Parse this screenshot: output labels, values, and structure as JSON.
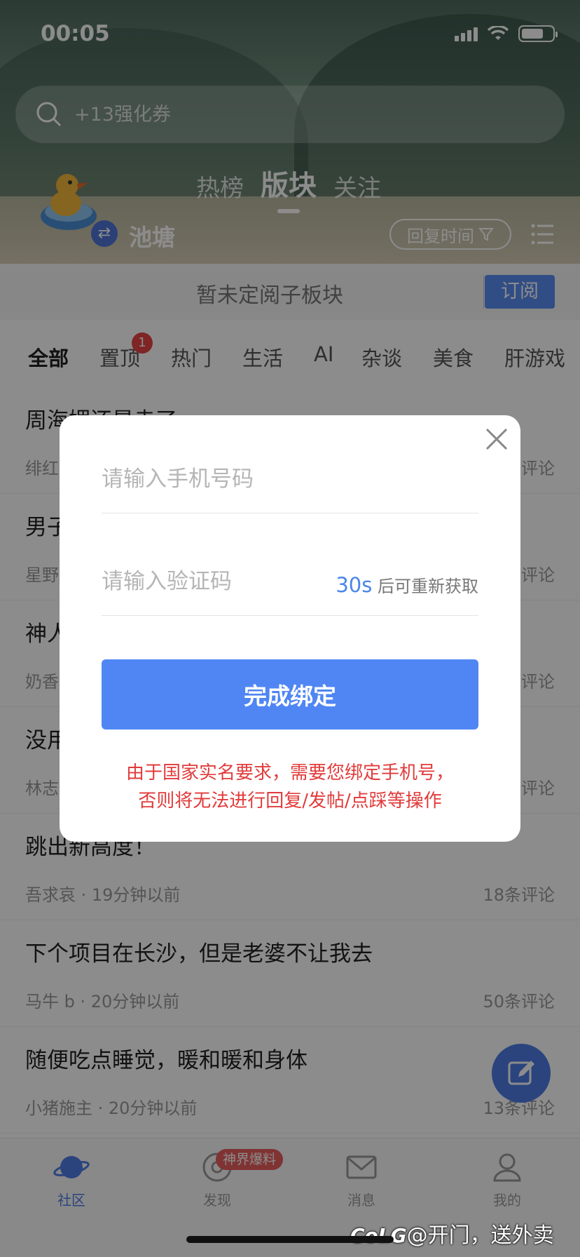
{
  "status_bar": {
    "time": "00:05"
  },
  "search": {
    "placeholder": "+13强化券"
  },
  "top_tabs": [
    {
      "label": "热榜",
      "active": false
    },
    {
      "label": "版块",
      "active": true
    },
    {
      "label": "关注",
      "active": false
    }
  ],
  "forum": {
    "name": "池塘",
    "swap_icon": "⇄",
    "sort_label": "回复时间"
  },
  "subscribe": {
    "message": "暂未定阅子板块",
    "button": "订阅"
  },
  "categories": [
    {
      "label": "全部",
      "active": true
    },
    {
      "label": "置顶",
      "badge": "1"
    },
    {
      "label": "热门"
    },
    {
      "label": "生活"
    },
    {
      "label": "AI"
    },
    {
      "label": "杂谈"
    },
    {
      "label": "美食"
    },
    {
      "label": "肝游戏"
    }
  ],
  "posts": [
    {
      "title": "周海媚还是走了",
      "meta": "绯红",
      "comments": "评论"
    },
    {
      "title": "男子",
      "meta": "星野",
      "comments": "评论"
    },
    {
      "title": "神人",
      "meta": "奶香",
      "comments": "评论"
    },
    {
      "title": "没用",
      "meta": "林志",
      "comments": "评论"
    },
    {
      "title": "跳出新高度！",
      "meta": "吾求哀 · 19分钟以前",
      "comments": "18条评论"
    },
    {
      "title": "下个项目在长沙，但是老婆不让我去",
      "meta": "马牛 b · 20分钟以前",
      "comments": "50条评论"
    },
    {
      "title": "随便吃点睡觉，暖和暖和身体",
      "meta": "小猪施主 · 20分钟以前",
      "comments": "13条评论"
    }
  ],
  "bottom_nav": [
    {
      "label": "社区",
      "icon": "planet-icon",
      "active": true
    },
    {
      "label": "发现",
      "icon": "discover-icon"
    },
    {
      "label": "消息",
      "icon": "mail-icon"
    },
    {
      "label": "我的",
      "icon": "user-icon"
    }
  ],
  "promo_badge": "神界爆料",
  "watermark": {
    "brand": "CoLG",
    "text": "@开门，送外卖"
  },
  "modal": {
    "phone_placeholder": "请输入手机号码",
    "code_placeholder": "请输入验证码",
    "countdown": "30s",
    "resend_suffix": "后可重新获取",
    "submit_label": "完成绑定",
    "notice_line1": "由于国家实名要求，需要您绑定手机号，",
    "notice_line2": "否则将无法进行回复/发帖/点踩等操作"
  },
  "colors": {
    "accent": "#4f86f4",
    "warning": "#e23b3b",
    "badge": "#e84444"
  }
}
